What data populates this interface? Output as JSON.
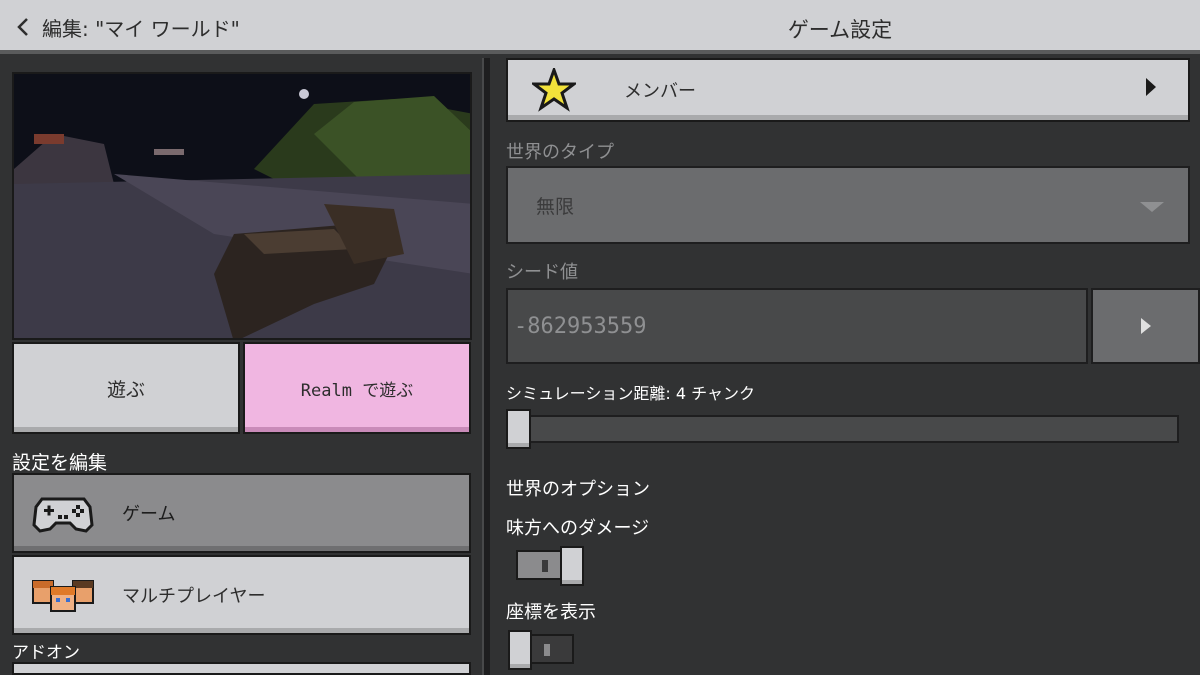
{
  "header": {
    "back_label": "編集: \"マイ ワールド\"",
    "title": "ゲーム設定"
  },
  "left": {
    "play_label": "遊ぶ",
    "realm_label": "Realm で遊ぶ",
    "edit_settings_label": "設定を編集",
    "nav": [
      {
        "label": "ゲーム",
        "icon": "controller-icon"
      },
      {
        "label": "マルチプレイヤー",
        "icon": "players-icon"
      }
    ],
    "addons_label": "アドオン"
  },
  "right": {
    "members_label": "メンバー",
    "world_type_label": "世界のタイプ",
    "world_type_value": "無限",
    "seed_label": "シード値",
    "seed_value": "-862953559",
    "sim_distance_label": "シミュレーション距離: 4 チャンク",
    "world_options_label": "世界のオプション",
    "friendly_fire_label": "味方へのダメージ",
    "friendly_fire_on": true,
    "show_coords_label": "座標を表示",
    "show_coords_on": false
  },
  "colors": {
    "accent_realm": "#f0b6e1",
    "button_light": "#d0d1d4",
    "panel_bg": "#313233"
  }
}
